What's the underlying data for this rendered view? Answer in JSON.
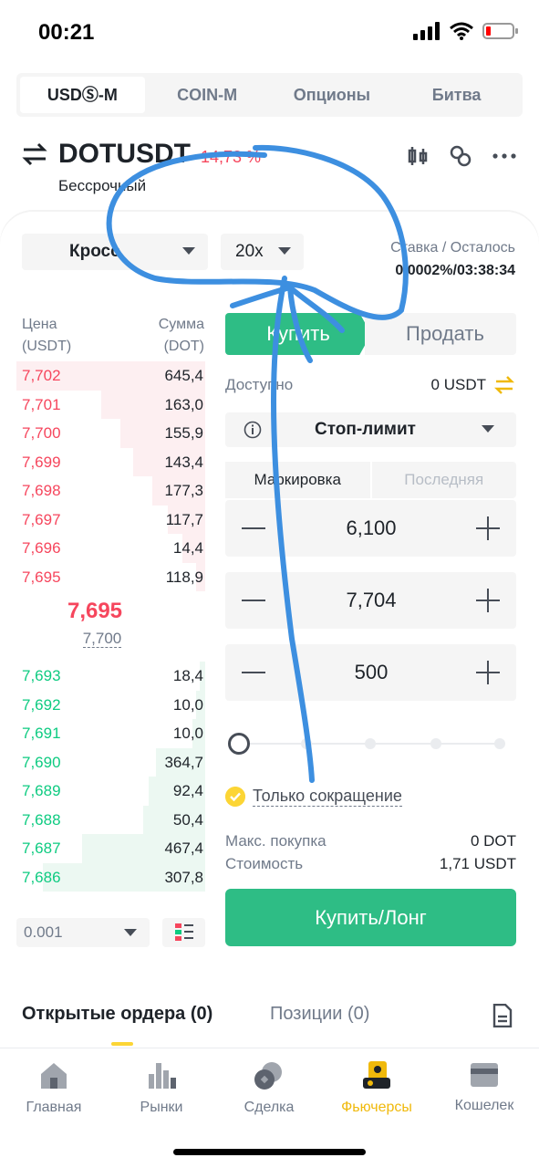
{
  "status_bar": {
    "time": "00:21"
  },
  "top_tabs": [
    {
      "label": "USDⓈ-M",
      "active": true
    },
    {
      "label": "COIN-M",
      "active": false
    },
    {
      "label": "Опционы",
      "active": false
    },
    {
      "label": "Битва",
      "active": false
    }
  ],
  "symbol": {
    "name": "DOTUSDT",
    "change": "-14,73 %",
    "subtitle": "Бессрочный"
  },
  "margin_mode": "Кросс",
  "leverage": "20x",
  "funding": {
    "label": "Ставка / Осталось",
    "value": "0.0002%/03:38:34"
  },
  "order_book": {
    "header_price": "Цена (USDT)",
    "header_price_line1": "Цена",
    "header_price_line2": "(USDT)",
    "header_amount_line1": "Сумма",
    "header_amount_line2": "(DOT)",
    "asks": [
      {
        "price": "7,702",
        "amount": "645,4",
        "depth": 1.0
      },
      {
        "price": "7,701",
        "amount": "163,0",
        "depth": 0.55
      },
      {
        "price": "7,700",
        "amount": "155,9",
        "depth": 0.45
      },
      {
        "price": "7,699",
        "amount": "143,4",
        "depth": 0.38
      },
      {
        "price": "7,698",
        "amount": "177,3",
        "depth": 0.28
      },
      {
        "price": "7,697",
        "amount": "117,7",
        "depth": 0.2
      },
      {
        "price": "7,696",
        "amount": "14,4",
        "depth": 0.12
      },
      {
        "price": "7,695",
        "amount": "118,9",
        "depth": 0.05
      }
    ],
    "mid_price": "7,695",
    "mark_price": "7,700",
    "bids": [
      {
        "price": "7,693",
        "amount": "18,4",
        "depth": 0.03
      },
      {
        "price": "7,692",
        "amount": "10,0",
        "depth": 0.05
      },
      {
        "price": "7,691",
        "amount": "10,0",
        "depth": 0.07
      },
      {
        "price": "7,690",
        "amount": "364,7",
        "depth": 0.26
      },
      {
        "price": "7,689",
        "amount": "92,4",
        "depth": 0.3
      },
      {
        "price": "7,688",
        "amount": "50,4",
        "depth": 0.33
      },
      {
        "price": "7,687",
        "amount": "467,4",
        "depth": 0.65
      },
      {
        "price": "7,686",
        "amount": "307,8",
        "depth": 0.86
      }
    ],
    "step": "0.001"
  },
  "trade": {
    "buy_tab": "Купить",
    "sell_tab": "Продать",
    "available_label": "Доступно",
    "available_value": "0 USDT",
    "order_type": "Стоп-лимит",
    "price_source_tabs": [
      {
        "label": "Маркировка",
        "active": true
      },
      {
        "label": "Последняя",
        "active": false
      }
    ],
    "stop_price": "6,100",
    "limit_price": "7,704",
    "amount": "500",
    "slider_percent": 0,
    "reduce_only": "Только сокращение",
    "max_buy_label": "Макс. покупка",
    "max_buy_value": "0 DOT",
    "cost_label": "Стоимость",
    "cost_value": "1,71 USDT",
    "submit": "Купить/Лонг"
  },
  "bottom_tabs": {
    "orders": "Открытые ордера (0)",
    "positions": "Позиции  (0)"
  },
  "nav": [
    {
      "label": "Главная",
      "icon": "home-icon",
      "active": false
    },
    {
      "label": "Рынки",
      "icon": "markets-icon",
      "active": false
    },
    {
      "label": "Сделка",
      "icon": "trade-icon",
      "active": false
    },
    {
      "label": "Фьючерсы",
      "icon": "futures-icon",
      "active": true
    },
    {
      "label": "Кошелек",
      "icon": "wallet-icon",
      "active": false
    }
  ],
  "colors": {
    "buy": "#2ebd85",
    "sell": "#f6465d",
    "accent": "#f0b90b",
    "scribble": "#3d8fe0"
  }
}
